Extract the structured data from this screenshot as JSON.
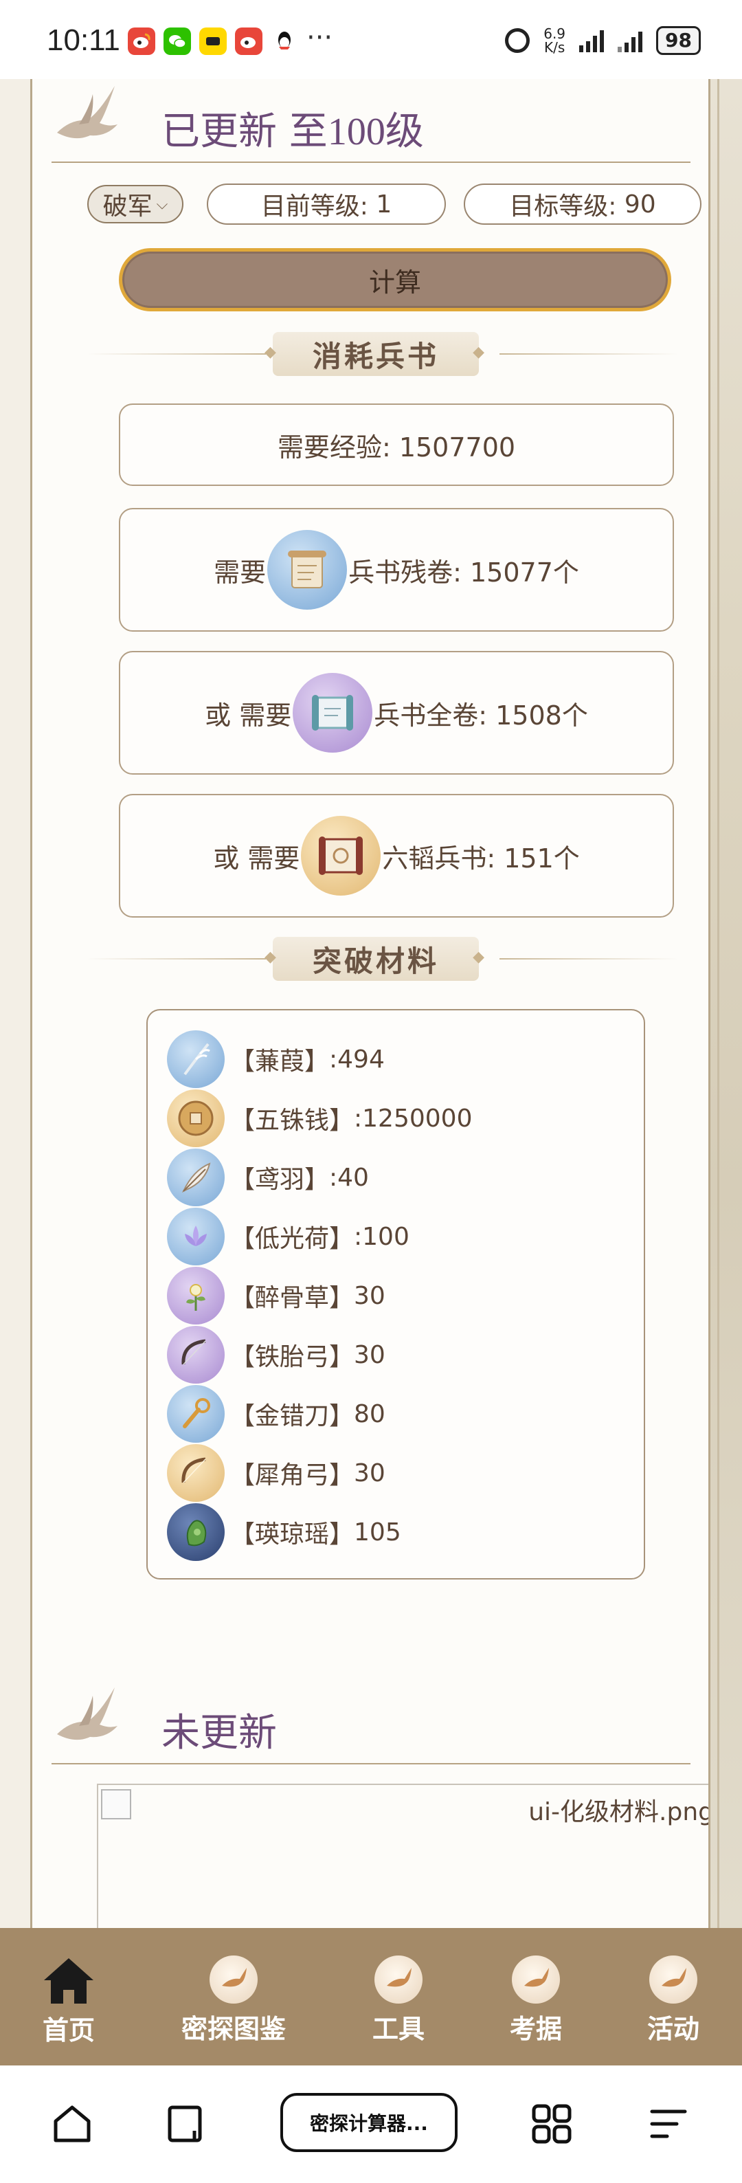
{
  "status_bar": {
    "time": "10:11",
    "dots": "···",
    "net_speed_value": "6.9",
    "net_speed_unit": "K/s",
    "battery": "98"
  },
  "updated_section": {
    "title_prefix": "已更新 至",
    "title_level": "100级"
  },
  "form": {
    "class_select": "破军",
    "current_level_label": "目前等级:",
    "current_level_value": "1",
    "target_level_label": "目标等级:",
    "target_level_value": "90",
    "calculate_button": "计算"
  },
  "consume_section": {
    "heading": "消耗兵书",
    "exp": "需要经验:  1507700",
    "options": [
      {
        "prefix": "需要",
        "item": "兵书残卷",
        "amount": ":  15077个"
      },
      {
        "prefix": "或 需要",
        "item": "兵书全卷",
        "amount": ":  1508个"
      },
      {
        "prefix": "或 需要",
        "item": "六韬兵书",
        "amount": ":  151个"
      }
    ]
  },
  "breakthrough_section": {
    "heading": "突破材料",
    "materials": [
      {
        "name": "【蒹葭】",
        "qty": ":494"
      },
      {
        "name": "【五铢钱】",
        "qty": ":1250000"
      },
      {
        "name": "【鸢羽】",
        "qty": ":40"
      },
      {
        "name": "【低光荷】",
        "qty": ":100"
      },
      {
        "name": "【醉骨草】",
        "qty": "30"
      },
      {
        "name": "【铁胎弓】",
        "qty": "30"
      },
      {
        "name": "【金错刀】",
        "qty": "80"
      },
      {
        "name": "【犀角弓】",
        "qty": "30"
      },
      {
        "name": "【瑛琼瑶】",
        "qty": "105"
      }
    ]
  },
  "not_updated_section": {
    "title": "未更新",
    "broken_image_alt": "ui-化级材料.png"
  },
  "bottom_nav": [
    {
      "label": "首页"
    },
    {
      "label": "密探图鉴"
    },
    {
      "label": "工具"
    },
    {
      "label": "考据"
    },
    {
      "label": "活动"
    }
  ],
  "system_nav": {
    "current_tab": "密探计算器..."
  },
  "colors": {
    "nav_bar": "#a48a68",
    "title_purple": "#6c4b78",
    "button_border_gold": "#e0a83a",
    "button_fill": "#9d8372",
    "card_border": "#b39f85"
  }
}
